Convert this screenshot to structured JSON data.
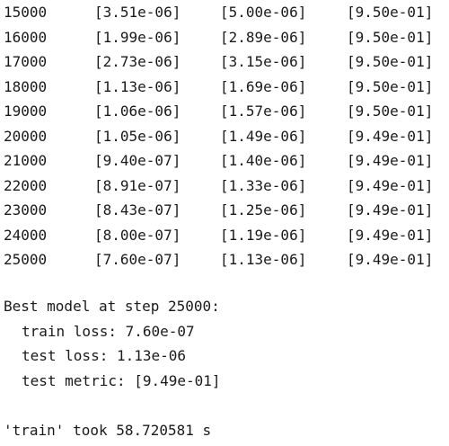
{
  "table": {
    "rows": [
      {
        "step": "15000",
        "train_loss": "[3.51e-06]",
        "test_loss": "[5.00e-06]",
        "test_metric": "[9.50e-01]"
      },
      {
        "step": "16000",
        "train_loss": "[1.99e-06]",
        "test_loss": "[2.89e-06]",
        "test_metric": "[9.50e-01]"
      },
      {
        "step": "17000",
        "train_loss": "[2.73e-06]",
        "test_loss": "[3.15e-06]",
        "test_metric": "[9.50e-01]"
      },
      {
        "step": "18000",
        "train_loss": "[1.13e-06]",
        "test_loss": "[1.69e-06]",
        "test_metric": "[9.50e-01]"
      },
      {
        "step": "19000",
        "train_loss": "[1.06e-06]",
        "test_loss": "[1.57e-06]",
        "test_metric": "[9.50e-01]"
      },
      {
        "step": "20000",
        "train_loss": "[1.05e-06]",
        "test_loss": "[1.49e-06]",
        "test_metric": "[9.49e-01]"
      },
      {
        "step": "21000",
        "train_loss": "[9.40e-07]",
        "test_loss": "[1.40e-06]",
        "test_metric": "[9.49e-01]"
      },
      {
        "step": "22000",
        "train_loss": "[8.91e-07]",
        "test_loss": "[1.33e-06]",
        "test_metric": "[9.49e-01]"
      },
      {
        "step": "23000",
        "train_loss": "[8.43e-07]",
        "test_loss": "[1.25e-06]",
        "test_metric": "[9.49e-01]"
      },
      {
        "step": "24000",
        "train_loss": "[8.00e-07]",
        "test_loss": "[1.19e-06]",
        "test_metric": "[9.49e-01]"
      },
      {
        "step": "25000",
        "train_loss": "[7.60e-07]",
        "test_loss": "[1.13e-06]",
        "test_metric": "[9.49e-01]"
      }
    ]
  },
  "summary": {
    "heading": "Best model at step 25000:",
    "train_loss": "train loss: 7.60e-07",
    "test_loss": "test loss: 1.13e-06",
    "test_metric": "test metric: [9.49e-01]"
  },
  "timing": "'train' took 58.720581 s"
}
